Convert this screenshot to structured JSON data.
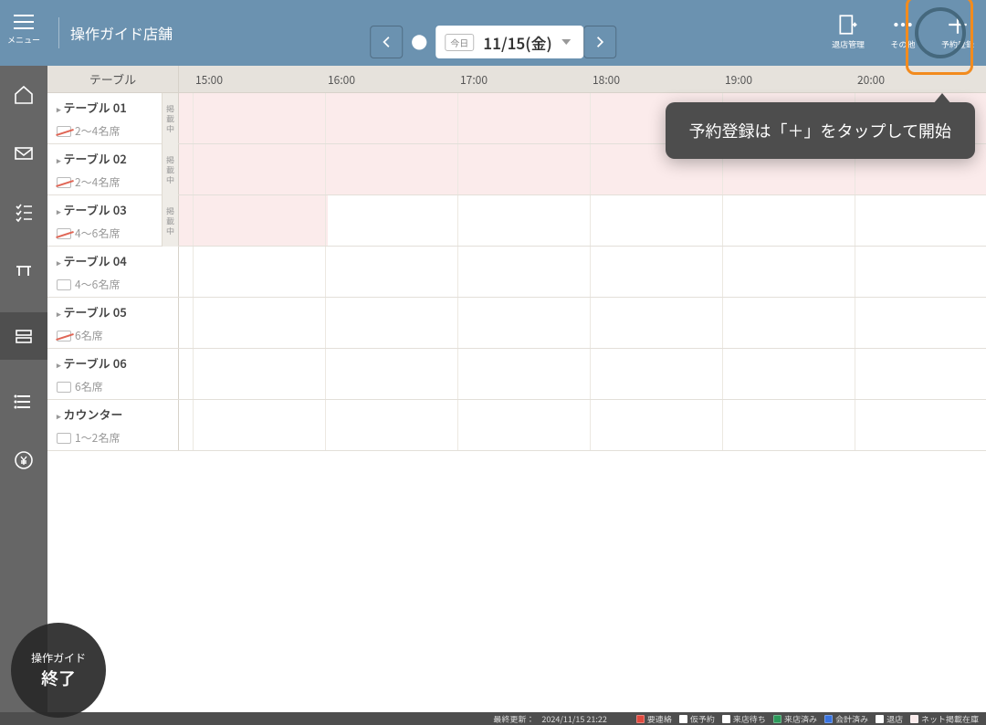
{
  "header": {
    "menu_label": "メニュー",
    "store_name": "操作ガイド店舗",
    "today_badge": "今日",
    "date_text": "11/15(金)",
    "right_items": [
      {
        "id": "exit-manage",
        "label": "退店管理"
      },
      {
        "id": "more",
        "label": "その他"
      },
      {
        "id": "add",
        "label": "予約登録"
      }
    ]
  },
  "tooltip_text": "予約登録は「＋」をタップして開始",
  "rail_icons": [
    "home",
    "mail",
    "checklist",
    "table",
    "seat",
    "list",
    "money"
  ],
  "grid": {
    "table_header": "テーブル",
    "hours": [
      "15:00",
      "16:00",
      "17:00",
      "18:00",
      "19:00",
      "20:00"
    ],
    "rows": [
      {
        "name": "テーブル 01",
        "capacity": "2〜4名席",
        "smoking": true,
        "badge": "掲載中",
        "pink": true
      },
      {
        "name": "テーブル 02",
        "capacity": "2〜4名席",
        "smoking": true,
        "badge": "掲載中",
        "pink": true
      },
      {
        "name": "テーブル 03",
        "capacity": "4〜6名席",
        "smoking": true,
        "badge": "掲載中",
        "pink_partial": true
      },
      {
        "name": "テーブル 04",
        "capacity": "4〜6名席",
        "smoking": false,
        "badge": "",
        "pink": false
      },
      {
        "name": "テーブル 05",
        "capacity": "6名席",
        "smoking": true,
        "badge": "",
        "pink": false
      },
      {
        "name": "テーブル 06",
        "capacity": "6名席",
        "smoking": false,
        "badge": "",
        "pink": false
      },
      {
        "name": "カウンター",
        "capacity": "1〜2名席",
        "smoking": false,
        "badge": "",
        "pink": false
      }
    ]
  },
  "footer": {
    "updated_label": "最終更新：",
    "updated_value": "2024/11/15 21:22",
    "legend": [
      {
        "color": "#e04a3f",
        "label": "要連絡"
      },
      {
        "color": "#ffffff",
        "label": "仮予約"
      },
      {
        "color": "#ffffff",
        "label": "来店待ち"
      },
      {
        "color": "#2d9a5b",
        "label": "来店済み"
      },
      {
        "color": "#3a74e0",
        "label": "会計済み"
      },
      {
        "color": "#ffffff",
        "label": "退店"
      },
      {
        "color": "#fbebeb",
        "label": "ネット掲載在庫"
      }
    ]
  },
  "exit_bubble": {
    "line1": "操作ガイド",
    "line2": "終了"
  }
}
